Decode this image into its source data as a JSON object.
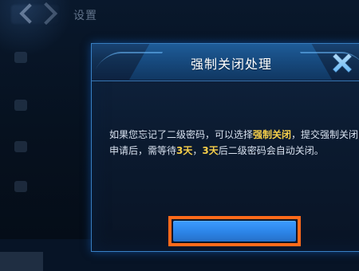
{
  "top_bar": {
    "title": "设置"
  },
  "dialog": {
    "title": "强制关闭处理",
    "body": {
      "line1": {
        "part1": "如果您忘记了二级密码，可以选择",
        "highlight": "强制关闭",
        "part2": "，提交强制关闭"
      },
      "line2": {
        "part1": "申请后，需等待",
        "highlight1": "3天",
        "part2": "，",
        "highlight2": "3天",
        "part3": "后二级密码会自动关闭。"
      }
    }
  },
  "colors": {
    "accent_blue": "#4aaeff",
    "highlight_yellow": "#f7cf4a",
    "focus_orange": "#ff6a1a"
  },
  "icons": {
    "close": "close-icon",
    "back": "back-icon"
  }
}
